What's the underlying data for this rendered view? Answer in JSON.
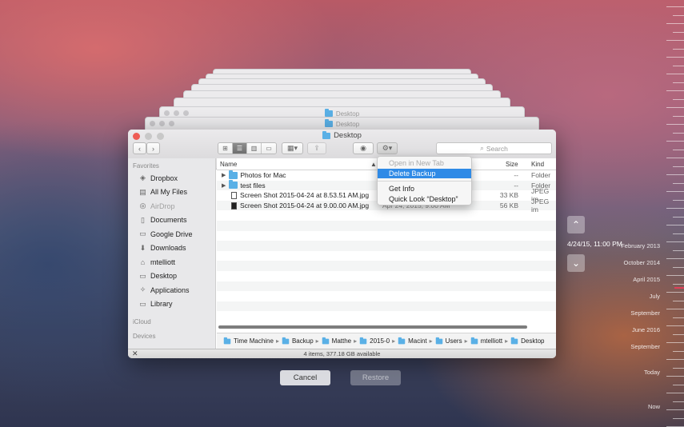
{
  "backdrop": {
    "ghost_titles": [
      "Desktop",
      "Desktop"
    ]
  },
  "window": {
    "title": "Desktop",
    "search_placeholder": "Search",
    "sidebar": {
      "favorites_header": "Favorites",
      "items": [
        {
          "label": "Dropbox",
          "icon": "dropbox-icon",
          "glyph": "◈"
        },
        {
          "label": "All My Files",
          "icon": "all-files-icon",
          "glyph": "▤"
        },
        {
          "label": "AirDrop",
          "icon": "airdrop-icon",
          "glyph": "◎",
          "dim": true
        },
        {
          "label": "Documents",
          "icon": "documents-icon",
          "glyph": "▯"
        },
        {
          "label": "Google Drive",
          "icon": "folder-icon",
          "glyph": "▭"
        },
        {
          "label": "Downloads",
          "icon": "downloads-icon",
          "glyph": "⬇"
        },
        {
          "label": "mtelliott",
          "icon": "home-icon",
          "glyph": "⌂"
        },
        {
          "label": "Desktop",
          "icon": "desktop-icon",
          "glyph": "▭"
        },
        {
          "label": "Applications",
          "icon": "applications-icon",
          "glyph": "✧"
        },
        {
          "label": "Library",
          "icon": "folder-icon",
          "glyph": "▭"
        }
      ],
      "icloud_header": "iCloud",
      "devices_header": "Devices"
    },
    "columns": {
      "name": "Name",
      "size": "Size",
      "kind": "Kind"
    },
    "files": [
      {
        "name": "Photos for Mac",
        "date": "",
        "size": "--",
        "kind": "Folder",
        "type": "folder"
      },
      {
        "name": "test files",
        "date": "",
        "size": "--",
        "kind": "Folder",
        "type": "folder"
      },
      {
        "name": "Screen Shot 2015-04-24 at 8.53.51 AM.jpg",
        "date": "",
        "size": "33 KB",
        "kind": "JPEG im",
        "type": "image"
      },
      {
        "name": "Screen Shot 2015-04-24 at 9.00.00 AM.jpg",
        "date": "Apr 24, 2015, 9:00 AM",
        "size": "56 KB",
        "kind": "JPEG im",
        "type": "image-dark"
      }
    ],
    "path": [
      "Time Machine",
      "Backup",
      "Matthe",
      "2015-0",
      "Macint",
      "Users",
      "mtelliott",
      "Desktop"
    ],
    "status": "4 items, 377.18 GB available"
  },
  "context_menu": {
    "items": [
      {
        "label": "Open in New Tab",
        "state": "disabled"
      },
      {
        "label": "Delete Backup",
        "state": "selected"
      },
      {
        "label": "Get Info",
        "state": "normal"
      },
      {
        "label": "Quick Look “Desktop”",
        "state": "normal"
      }
    ]
  },
  "buttons": {
    "cancel": "Cancel",
    "restore": "Restore"
  },
  "timestamp": "4/24/15, 11:00 PM",
  "timeline": [
    "February 2013",
    "October 2014",
    "April 2015",
    "July",
    "September",
    "June 2016",
    "September",
    "Today",
    "Now"
  ],
  "colors": {
    "accent": "#2f8ae6",
    "close": "#ee5d55",
    "minimize": "#c8c8c8",
    "zoom": "#c8c8c8",
    "timeline_marker": "#e0405a"
  }
}
